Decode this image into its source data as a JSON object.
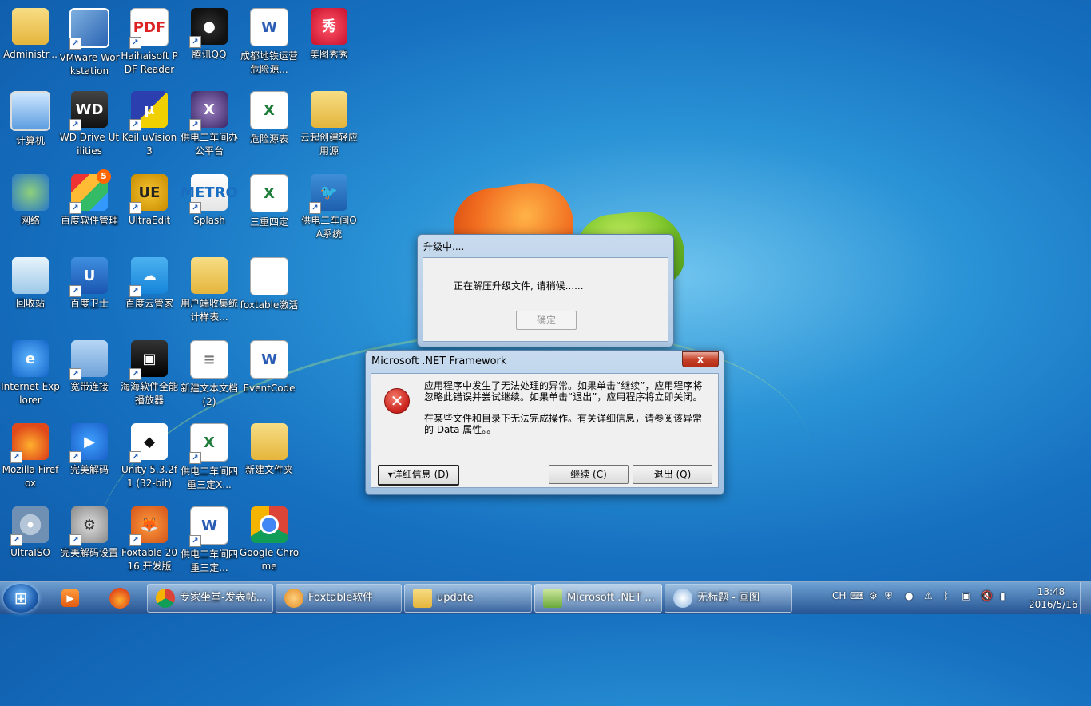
{
  "desktop": {
    "icons": [
      {
        "label": "Administr..."
      },
      {
        "label": "VMware Workstation"
      },
      {
        "label": "Haihaisoft PDF Reader"
      },
      {
        "label": "腾讯QQ"
      },
      {
        "label": "成都地铁运营危险源..."
      },
      {
        "label": "美图秀秀"
      },
      {
        "label": "计算机"
      },
      {
        "label": "WD Drive Utilities"
      },
      {
        "label": "Keil uVision3"
      },
      {
        "label": "供电二车间办公平台"
      },
      {
        "label": "危险源表"
      },
      {
        "label": "云起创建轻应用源"
      },
      {
        "label": "网络"
      },
      {
        "label": "百度软件管理"
      },
      {
        "label": "UltraEdit"
      },
      {
        "label": "Splash"
      },
      {
        "label": "三重四定"
      },
      {
        "label": "供电二车间OA系统"
      },
      {
        "label": "回收站"
      },
      {
        "label": "百度卫士"
      },
      {
        "label": "百度云管家"
      },
      {
        "label": "用户端收集统计样表..."
      },
      {
        "label": "foxtable激活"
      },
      {
        "label": "Internet Explorer"
      },
      {
        "label": "宽带连接"
      },
      {
        "label": "海海软件全能播放器"
      },
      {
        "label": "新建文本文档 (2)"
      },
      {
        "label": "EventCode"
      },
      {
        "label": "Mozilla Firefox"
      },
      {
        "label": "完美解码"
      },
      {
        "label": "Unity 5.3.2f1 (32-bit)"
      },
      {
        "label": "供电二车间四重三定X..."
      },
      {
        "label": "新建文件夹"
      },
      {
        "label": "UltraISO"
      },
      {
        "label": "完美解码设置"
      },
      {
        "label": "Foxtable 2016 开发版"
      },
      {
        "label": "供电二车间四重三定..."
      },
      {
        "label": "Google Chrome"
      }
    ],
    "badge_count": "5",
    "glyphs": {
      "pdf": "PDF",
      "word": "W",
      "excel": "X",
      "mx": "秀",
      "keil": "μ",
      "x": "X",
      "ue": "UE",
      "splash": "METRO",
      "ie": "e",
      "unity": "◆",
      "gear": "⚙",
      "fox": "🦊",
      "wd": "WD"
    }
  },
  "upgrade_dialog": {
    "title": "升级中....",
    "message": "正在解压升级文件, 请稍候......",
    "ok_label": "确定"
  },
  "error_dialog": {
    "title": "Microsoft .NET Framework",
    "close_label": "x",
    "icon_glyph": "✕",
    "message_1": "应用程序中发生了无法处理的异常。如果单击“继续”，应用程序将忽略此错误并尝试继续。如果单击“退出”，应用程序将立即关闭。",
    "message_2": "在某些文件和目录下无法完成操作。有关详细信息，请参阅该异常的 Data 属性。。",
    "details_label": "▾详细信息 (D)",
    "continue_label": "继续 (C)",
    "quit_label": "退出 (Q)"
  },
  "taskbar": {
    "tasks": [
      {
        "label": "专家坐堂-发表帖..."
      },
      {
        "label": "Foxtable软件"
      },
      {
        "label": "update"
      },
      {
        "label": "Microsoft .NET ..."
      },
      {
        "label": "无标题 - 画图"
      }
    ],
    "tray_lang": "CH",
    "time": "13:48",
    "date": "2016/5/16"
  },
  "colors": {
    "error_red": "#c8201a",
    "taskbar": "#2a5a96",
    "desktop_blue": "#1670c0"
  }
}
